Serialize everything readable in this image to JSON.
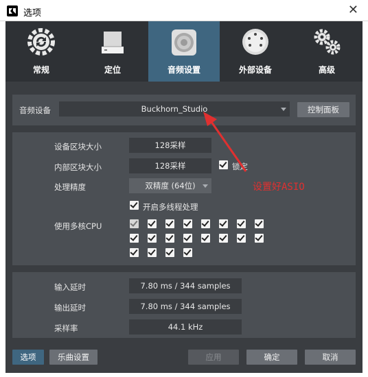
{
  "window": {
    "title": "选项"
  },
  "tabs": [
    {
      "label": "常规",
      "icon": "gear-sync-icon",
      "active": false
    },
    {
      "label": "定位",
      "icon": "drive-icon",
      "active": false
    },
    {
      "label": "音频设置",
      "icon": "speaker-icon",
      "active": true
    },
    {
      "label": "外部设备",
      "icon": "midi-port-icon",
      "active": false
    },
    {
      "label": "高级",
      "icon": "gears-icon",
      "active": false
    }
  ],
  "audio_device": {
    "label": "音频设备",
    "value": "Buckhorn_Studio",
    "control_panel": "控制面板"
  },
  "settings": {
    "device_block_label": "设备区块大小",
    "device_block_value": "128采样",
    "internal_block_label": "内部区块大小",
    "internal_block_value": "128采样",
    "lock_label": "锁定",
    "precision_label": "处理精度",
    "precision_value": "双精度 (64位)",
    "multithread_label": "开启多线程处理",
    "multicore_label": "使用多核CPU",
    "cpu_cores_checked": [
      true,
      true,
      true,
      true,
      true,
      true,
      true,
      true,
      true,
      true,
      true,
      true,
      true,
      true,
      true,
      true,
      true,
      true,
      true,
      true
    ],
    "cpu_cores_enabled_count": 19
  },
  "latency": {
    "input_label": "输入延时",
    "input_value": "7.80 ms / 344 samples",
    "output_label": "输出延时",
    "output_value": "7.80 ms / 344 samples",
    "rate_label": "采样率",
    "rate_value": "44.1 kHz"
  },
  "footer": {
    "options": "选项",
    "song_settings": "乐曲设置",
    "apply": "应用",
    "ok": "确定",
    "cancel": "取消"
  },
  "annotation": {
    "text": "设置好ASIO",
    "color": "#e03030"
  },
  "colors": {
    "active_tab": "#3f6680",
    "panel": "#4b4f54",
    "background": "#3a3d41"
  }
}
